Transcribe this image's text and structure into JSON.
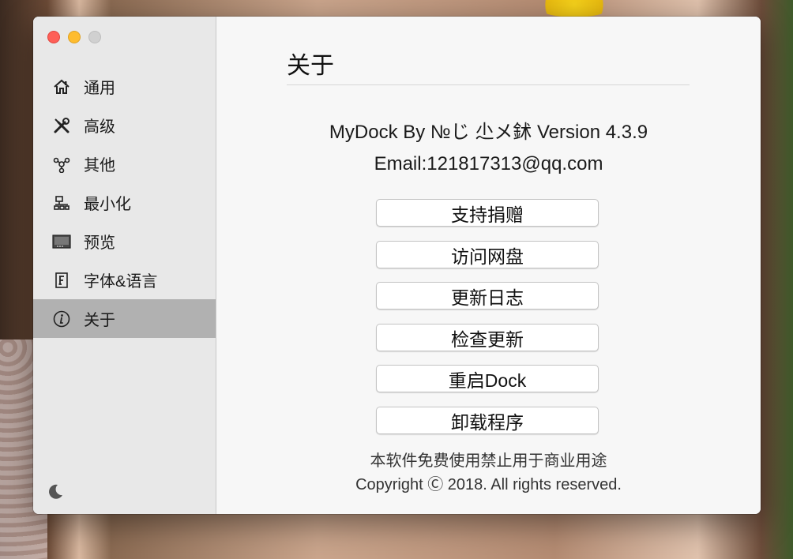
{
  "sidebar": {
    "items": [
      {
        "label": "通用",
        "icon": "home-icon",
        "active": false
      },
      {
        "label": "高级",
        "icon": "tools-icon",
        "active": false
      },
      {
        "label": "其他",
        "icon": "network-icon",
        "active": false
      },
      {
        "label": "最小化",
        "icon": "minimize-icon",
        "active": false
      },
      {
        "label": "预览",
        "icon": "preview-icon",
        "active": false
      },
      {
        "label": "字体&语言",
        "icon": "font-icon",
        "active": false
      },
      {
        "label": "关于",
        "icon": "info-icon",
        "active": true
      }
    ],
    "bottom_icon": "moon-icon"
  },
  "main": {
    "title": "关于",
    "version_line": "MyDock By №じ 尐メ鉥  Version 4.3.9",
    "email_line": "Email:121817313@qq.com",
    "buttons": [
      {
        "label": "支持捐赠"
      },
      {
        "label": "访问网盘"
      },
      {
        "label": "更新日志"
      },
      {
        "label": "检查更新"
      },
      {
        "label": "重启Dock"
      },
      {
        "label": "卸载程序"
      }
    ],
    "footer_notice": "本软件免费使用禁止用于商业用途",
    "copyright": "Copyright Ⓒ 2018. All rights reserved."
  },
  "colors": {
    "sidebar_bg": "#e8e8e8",
    "active_item_bg": "#b1b1b1",
    "content_bg": "#f7f7f7",
    "close": "#fe5f57",
    "minimize": "#febc2e",
    "zoom_disabled": "#d0d0d0"
  }
}
